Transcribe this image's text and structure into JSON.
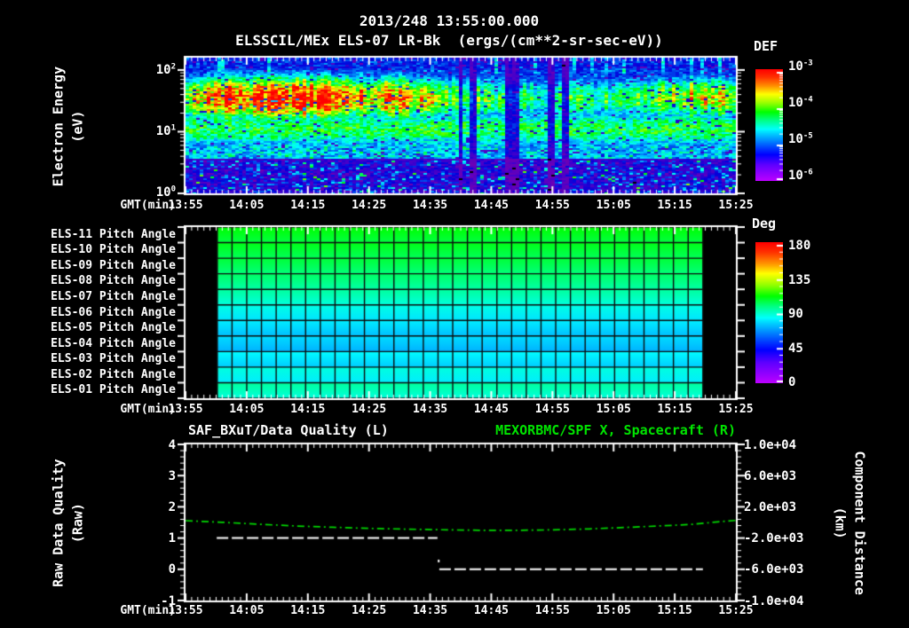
{
  "header": {
    "date_title": "2013/248 13:55:00.000",
    "plot_title": "ELSSCIL/MEx ELS-07 LR-Bk  (ergs/(cm**2-sr-sec-eV))"
  },
  "colors": {
    "background": "#000000",
    "text": "#ffffff",
    "frame": "#ffffff",
    "green_series": "#00d800",
    "green_title": "#00e400",
    "grid_line": "#0d0d0d"
  },
  "time_axis": {
    "label": "GMT(min)",
    "ticks": [
      "13:55",
      "14:05",
      "14:15",
      "14:25",
      "14:35",
      "14:45",
      "14:55",
      "15:05",
      "15:15",
      "15:25"
    ]
  },
  "spectrogram": {
    "ylabel_line1": "Electron Energy",
    "ylabel_line2": "(eV)",
    "ytick_exponents": [
      2,
      1,
      0
    ],
    "colorbar": {
      "title": "DEF",
      "tick_exponents": [
        -3,
        -4,
        -5,
        -6
      ]
    }
  },
  "pitch_panel": {
    "row_labels": [
      "ELS-11 Pitch Angle",
      "ELS-10 Pitch Angle",
      "ELS-09 Pitch Angle",
      "ELS-08 Pitch Angle",
      "ELS-07 Pitch Angle",
      "ELS-06 Pitch Angle",
      "ELS-05 Pitch Angle",
      "ELS-04 Pitch Angle",
      "ELS-03 Pitch Angle",
      "ELS-02 Pitch Angle",
      "ELS-01 Pitch Angle"
    ],
    "colorbar": {
      "title": "Deg",
      "ticks": [
        "180",
        "135",
        "90",
        "45",
        "0"
      ]
    }
  },
  "quality_panel": {
    "title_left": "SAF_BXuT/Data Quality (L)",
    "title_right": "MEXORBMC/SPF X, Spacecraft (R)",
    "ylabel_left_line1": "Raw Data Quality",
    "ylabel_left_line2": "(Raw)",
    "ylabel_right_line1": "Component Distance",
    "ylabel_right_line2": "(km)",
    "left_ticks": [
      "4",
      "3",
      "2",
      "1",
      "0",
      "-1"
    ],
    "right_ticks": [
      "1.0e+04",
      "6.0e+03",
      "2.0e+03",
      "-2.0e+03",
      "-6.0e+03",
      "-1.0e+04"
    ]
  },
  "chart_data": [
    {
      "type": "heatmap",
      "name": "electron_energy_spectrogram",
      "title": "ELSSCIL/MEx ELS-07 LR-Bk  (ergs/(cm**2-sr-sec-eV))",
      "xlabel": "GMT(min)",
      "ylabel": "Electron Energy (eV)",
      "x_tick_labels": [
        "13:55",
        "14:05",
        "14:15",
        "14:25",
        "14:35",
        "14:45",
        "14:55",
        "15:05",
        "15:15",
        "15:25"
      ],
      "x_minutes_range": [
        0,
        90
      ],
      "y_scale": "log",
      "y_range_eV": [
        1,
        158
      ],
      "value_units": "DEF ergs/(cm**2-sr-sec-eV)",
      "value_range_exponents": [
        -6,
        -3
      ],
      "main_band": {
        "logE_center": 1.55,
        "logE_sigma": 0.3,
        "intensity_vs_t": [
          [
            0,
            0.72
          ],
          [
            0.05,
            0.9
          ],
          [
            0.08,
            0.95
          ],
          [
            0.12,
            0.9
          ],
          [
            0.15,
            0.97
          ],
          [
            0.2,
            0.95
          ],
          [
            0.25,
            0.97
          ],
          [
            0.3,
            0.85
          ],
          [
            0.34,
            0.8
          ],
          [
            0.38,
            0.85
          ],
          [
            0.42,
            0.8
          ],
          [
            0.45,
            0.72
          ],
          [
            0.5,
            0.62
          ],
          [
            0.55,
            0.6
          ],
          [
            0.6,
            0.56
          ],
          [
            0.65,
            0.55
          ],
          [
            0.7,
            0.58
          ],
          [
            0.75,
            0.55
          ],
          [
            0.8,
            0.56
          ],
          [
            0.85,
            0.6
          ],
          [
            0.88,
            0.68
          ],
          [
            0.93,
            0.75
          ],
          [
            1,
            0.72
          ]
        ]
      },
      "secondary_band": {
        "logE_center": 1.05,
        "logE_sigma": 0.28,
        "intensity": 0.58
      },
      "background_levels": {
        "above_100eV": 0.27,
        "mid": 0.3,
        "cyan_band_3_7eV": 0.42,
        "below_3eV": 0.16
      },
      "dark_stripes_t": [
        0.5,
        0.52,
        0.585,
        0.6,
        0.665,
        0.69
      ],
      "noise_seed": 20130248
    },
    {
      "type": "heatmap",
      "name": "pitch_angle_panel",
      "rows": [
        "ELS-11",
        "ELS-10",
        "ELS-09",
        "ELS-08",
        "ELS-07",
        "ELS-06",
        "ELS-05",
        "ELS-04",
        "ELS-03",
        "ELS-02",
        "ELS-01"
      ],
      "row_pitch_deg": [
        107,
        105,
        102,
        98,
        93,
        86,
        81,
        79,
        83,
        87,
        93
      ],
      "deg_range": [
        0,
        180
      ],
      "data_start_min": 5.2,
      "data_end_min": 84.6,
      "grid_columns": 33
    },
    {
      "type": "line",
      "name": "quality_and_distance",
      "series": [
        {
          "name": "SAF_BXuT/Data Quality (L)",
          "axis": "left",
          "color": "#ffffff",
          "line_style": "dashed",
          "segments": [
            {
              "value": 1,
              "start_min": 5.1,
              "end_min": 41.2
            },
            {
              "value": 0,
              "start_min": 41.5,
              "end_min": 84.6
            }
          ],
          "transition_point": {
            "min": 41.4,
            "value": 0.28
          }
        },
        {
          "name": "MEXORBMC/SPF X, Spacecraft (R)",
          "axis": "right",
          "color": "#00d800",
          "line_style": "dashed",
          "x_min": [
            0,
            6,
            12,
            18,
            24,
            30,
            36,
            42,
            48,
            54,
            60,
            66,
            72,
            78,
            83,
            87,
            90
          ],
          "y_km": [
            230,
            20,
            -230,
            -450,
            -620,
            -760,
            -860,
            -940,
            -1000,
            -1010,
            -950,
            -830,
            -640,
            -430,
            -240,
            80,
            260
          ]
        }
      ],
      "left_axis": {
        "label": "Raw Data Quality (Raw)",
        "range": [
          -1,
          4
        ]
      },
      "right_axis": {
        "label": "Component Distance (km)",
        "range": [
          -10000,
          10000
        ]
      }
    }
  ]
}
